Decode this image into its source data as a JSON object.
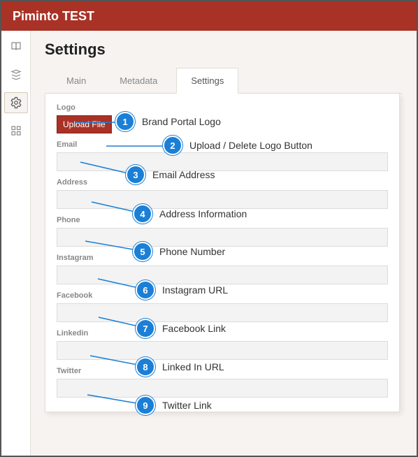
{
  "header": {
    "title": "Piminto TEST"
  },
  "page": {
    "title": "Settings"
  },
  "tabs": [
    {
      "label": "Main",
      "active": false
    },
    {
      "label": "Metadata",
      "active": false
    },
    {
      "label": "Settings",
      "active": true
    }
  ],
  "form": {
    "logo_label": "Logo",
    "upload_button": "Upload File",
    "email_label": "Email",
    "email_value": "",
    "address_label": "Address",
    "address_value": "",
    "phone_label": "Phone",
    "phone_value": "",
    "instagram_label": "Instagram",
    "instagram_value": "",
    "facebook_label": "Facebook",
    "facebook_value": "",
    "linkedin_label": "Linkedin",
    "linkedin_value": "",
    "twitter_label": "Twitter",
    "twitter_value": ""
  },
  "annotations": {
    "a1": "Brand Portal Logo",
    "a2": "Upload / Delete Logo Button",
    "a3": "Email Address",
    "a4": "Address Information",
    "a5": "Phone Number",
    "a6": "Instagram URL",
    "a7": "Facebook Link",
    "a8": "Linked In URL",
    "a9": "Twitter Link"
  },
  "colors": {
    "brand": "#a93226",
    "anno": "#1b7fd6"
  }
}
